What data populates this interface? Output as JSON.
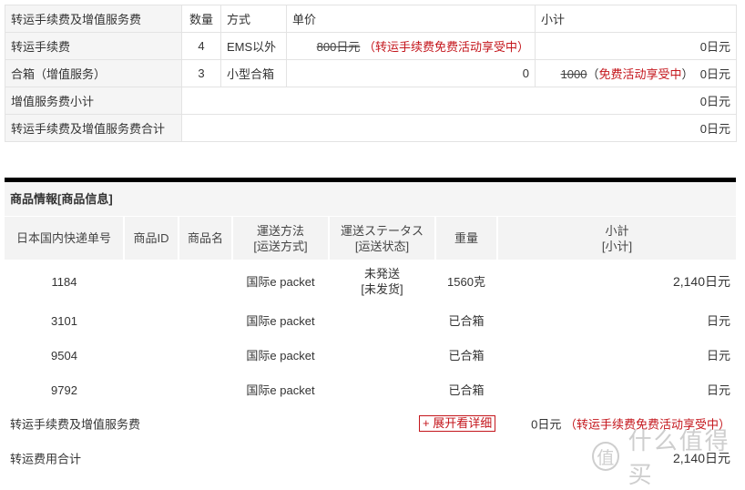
{
  "fee_table": {
    "header": {
      "label": "转运手续费及增值服务费",
      "qty": "数量",
      "method": "方式",
      "unit_price": "单价",
      "subtotal": "小计"
    },
    "rows": [
      {
        "label": "转运手续费",
        "qty": "4",
        "method": "EMS以外",
        "unit_price_original": "800日元",
        "unit_price_note": "（转运手续费免费活动享受中）",
        "subtotal": "0日元"
      },
      {
        "label": "合箱（增值服务）",
        "qty": "3",
        "method": "小型合箱",
        "unit_price": "0",
        "subtotal_original": "1000",
        "subtotal_note_open": "（",
        "subtotal_note": "免费活动享受中",
        "subtotal_note_close": "）",
        "subtotal": "0日元"
      }
    ],
    "summary": [
      {
        "label": "增值服务费小计",
        "value": "0日元"
      },
      {
        "label": "转运手续费及增值服务费合计",
        "value": "0日元"
      }
    ]
  },
  "goods": {
    "title": "商品情報[商品信息]",
    "columns": [
      {
        "line1": "日本国内快递单号",
        "line2": ""
      },
      {
        "line1": "商品ID",
        "line2": ""
      },
      {
        "line1": "商品名",
        "line2": ""
      },
      {
        "line1": "運送方法",
        "line2": "[运送方式]"
      },
      {
        "line1": "運送ステータス",
        "line2": "[运送状态]"
      },
      {
        "line1": "重量",
        "line2": ""
      },
      {
        "line1": "小計",
        "line2": "[小计]"
      }
    ],
    "rows": [
      {
        "tracking": "1184",
        "product_id": "",
        "product_name": "",
        "method": "国际e packet",
        "status": "未発送",
        "status_cn": "[未发货]",
        "weight": "1560克",
        "subtotal": "2,140日元"
      },
      {
        "tracking": "3101",
        "product_id": "",
        "product_name": "",
        "method": "国际e packet",
        "status": "",
        "status_cn": "",
        "weight": "已合箱",
        "subtotal": "日元"
      },
      {
        "tracking": "9504",
        "product_id": "",
        "product_name": "",
        "method": "国际e packet",
        "status": "",
        "status_cn": "",
        "weight": "已合箱",
        "subtotal": "日元"
      },
      {
        "tracking": "9792",
        "product_id": "",
        "product_name": "",
        "method": "国际e packet",
        "status": "",
        "status_cn": "",
        "weight": "已合箱",
        "subtotal": "日元"
      }
    ],
    "fee_row": {
      "label": "转运手续费及增值服务费",
      "expand_button": "+ 展开看详细",
      "value": "0日元",
      "note": "（转运手续费免费活动享受中）"
    },
    "total_row": {
      "label": "转运费用合计",
      "value": "2,140日元"
    }
  },
  "watermark": {
    "badge": "值",
    "text": "什么值得买"
  },
  "colors": {
    "accent_red": "#c4161c",
    "label_bg": "#f5f5f5",
    "border": "#e3e3e3",
    "section_bar": "#000000"
  }
}
